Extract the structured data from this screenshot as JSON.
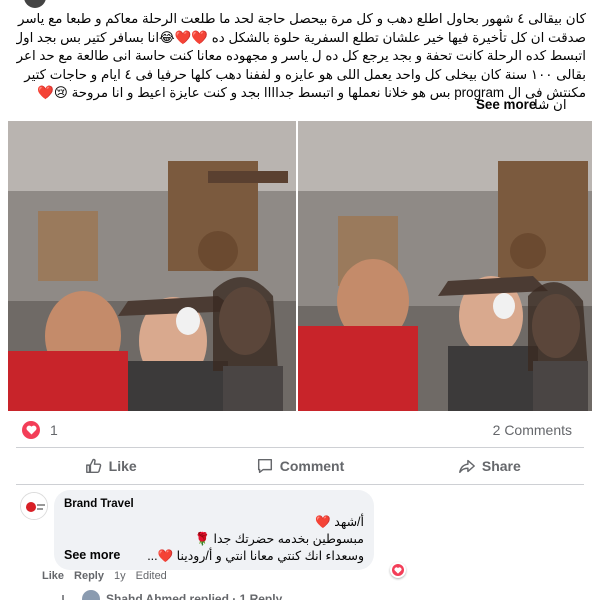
{
  "post": {
    "lines": [
      "كان بيقالى ٤ شهور بحاول اطلع دهب و كل مرة بيحصل حاجة لحد ما طلعت الرحلة معاكم و طبعا مع ياسر و",
      "صدقت ان كل تأخيرة فيها خير علشان تطلع السفرية حلوة بالشكل ده ❤️❤️😂انا بسافر كتير بس بجد اول مرة",
      "اتبسط كده الرحلة كانت تحفة و بجد يرجع كل ده ل ياسر و مجهوده معانا كنت حاسة انى طالعة مع حد اعرفه",
      "بقالى ١٠٠ سنة كان بيخلى كل واحد يعمل اللى هو عايزه و لففنا دهب كلها حرفيا فى ٤ ايام و حاجات كتير",
      "مكنتش فى ال program بس هو خلانا نعملها و اتبسط جداااا بجد و كنت عايزة اعيط و انا مروحة 😢❤️"
    ],
    "last_line": "ان شا",
    "see_more": "See more"
  },
  "stats": {
    "reaction_count": "1",
    "comments": "2 Comments"
  },
  "actions": {
    "like": "Like",
    "comment": "Comment",
    "share": "Share"
  },
  "comment": {
    "author": "Brand Travel",
    "lines": [
      "أ/شهد ❤️",
      "مبسوطين بخدمه حضرتك جدا 🌹",
      "وسعداء انك كنتي معانا انتي و أ/رودينا ❤️..."
    ],
    "see_more": "See more",
    "like": "Like",
    "reply": "Reply",
    "time": "1y",
    "edited": "Edited"
  },
  "replies": {
    "text": "Shahd Ahmed replied · 1 Reply"
  },
  "colors": {
    "heart": "#f33e58",
    "muted": "#65676b"
  }
}
